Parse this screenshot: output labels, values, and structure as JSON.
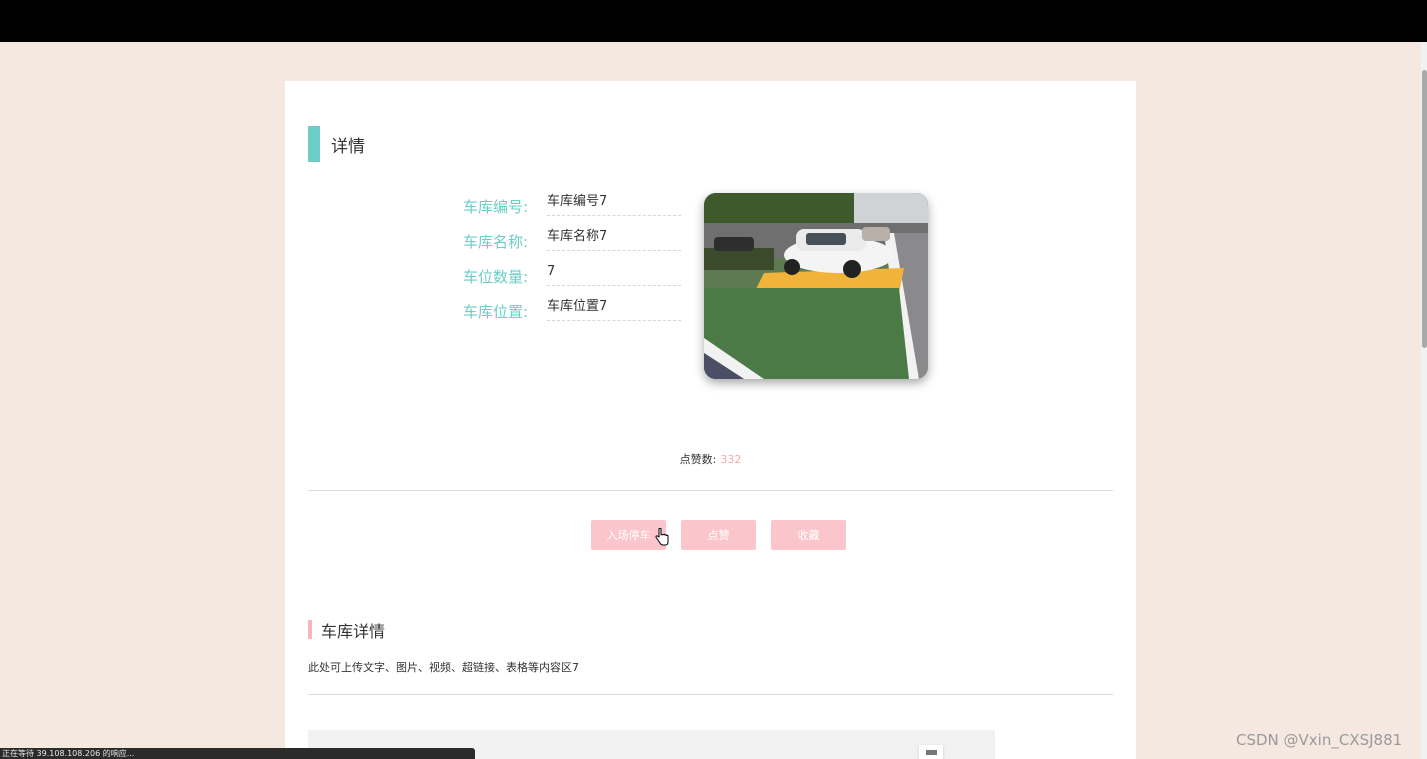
{
  "detail": {
    "section_title": "详情",
    "fields": [
      {
        "label": "车库编号:",
        "value": "车库编号7"
      },
      {
        "label": "车库名称:",
        "value": "车库名称7"
      },
      {
        "label": "车位数量:",
        "value": "7"
      },
      {
        "label": "车库位置:",
        "value": "车库位置7"
      }
    ],
    "likes_label": "点赞数:",
    "likes_count": "332"
  },
  "actions": {
    "park_label": "入场停车",
    "like_label": "点赞",
    "favorite_label": "收藏"
  },
  "garage_detail": {
    "title": "车库详情",
    "content": "此处可上传文字、图片、视频、超链接、表格等内容区7"
  },
  "status_bar": {
    "text": "正在等待 39.108.108.206 的响应..."
  },
  "watermark": "CSDN @Vxin_CXSJ881",
  "colors": {
    "page_bg": "#f5e8e1",
    "accent_teal": "#6ecdc8",
    "accent_pink": "#fbc6cb",
    "like_count": "#f5a9b0"
  }
}
